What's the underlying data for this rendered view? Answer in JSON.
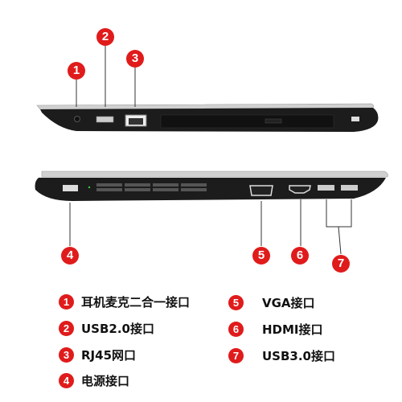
{
  "markers": [
    "1",
    "2",
    "3",
    "4",
    "5",
    "6",
    "7"
  ],
  "legend": [
    {
      "num": "1",
      "label": "耳机麦克二合一接口"
    },
    {
      "num": "2",
      "label": "USB2.0接口"
    },
    {
      "num": "3",
      "label": "RJ45网口"
    },
    {
      "num": "4",
      "label": "电源接口"
    },
    {
      "num": "5",
      "label": "VGA接口"
    },
    {
      "num": "6",
      "label": "HDMI接口"
    },
    {
      "num": "7",
      "label": "USB3.0接口"
    }
  ],
  "colors": {
    "marker": "#e01b1b",
    "body": "#1a1a1a",
    "trim": "#d8d8d8"
  }
}
